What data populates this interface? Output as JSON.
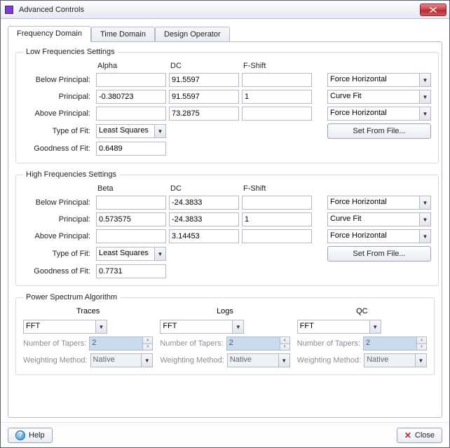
{
  "window": {
    "title": "Advanced Controls"
  },
  "tabs": {
    "freq": "Frequency Domain",
    "time": "Time Domain",
    "design": "Design Operator"
  },
  "low": {
    "legend": "Low Frequencies Settings",
    "hdr_alpha": "Alpha",
    "hdr_dc": "DC",
    "hdr_fshift": "F-Shift",
    "lbl_below": "Below Principal:",
    "lbl_principal": "Principal:",
    "lbl_above": "Above Principal:",
    "lbl_typefit": "Type of Fit:",
    "lbl_goodfit": "Goodness of Fit:",
    "below": {
      "alpha": "",
      "dc": "91.5597",
      "fshift": "",
      "mode": "Force Horizontal"
    },
    "principal": {
      "alpha": "-0.380723",
      "dc": "91.5597",
      "fshift": "1",
      "mode": "Curve Fit"
    },
    "above": {
      "alpha": "",
      "dc": "73.2875",
      "fshift": "",
      "mode": "Force Horizontal"
    },
    "typefit": "Least Squares",
    "setfromfile": "Set From File...",
    "goodfit": "0.6489"
  },
  "high": {
    "legend": "High Frequencies Settings",
    "hdr_beta": "Beta",
    "hdr_dc": "DC",
    "hdr_fshift": "F-Shift",
    "lbl_below": "Below Principal:",
    "lbl_principal": "Principal:",
    "lbl_above": "Above Principal:",
    "lbl_typefit": "Type of Fit:",
    "lbl_goodfit": "Goodness of Fit:",
    "below": {
      "beta": "",
      "dc": "-24.3833",
      "fshift": "",
      "mode": "Force Horizontal"
    },
    "principal": {
      "beta": "0.573575",
      "dc": "-24.3833",
      "fshift": "1",
      "mode": "Curve Fit"
    },
    "above": {
      "beta": "",
      "dc": "3.14453",
      "fshift": "",
      "mode": "Force Horizontal"
    },
    "typefit": "Least Squares",
    "setfromfile": "Set From File...",
    "goodfit": "0.7731"
  },
  "psa": {
    "legend": "Power Spectrum Algorithm",
    "hdr_traces": "Traces",
    "hdr_logs": "Logs",
    "hdr_qc": "QC",
    "lbl_tapers": "Number of Tapers:",
    "lbl_wmethod": "Weighting Method:",
    "traces": {
      "algo": "FFT",
      "tapers": "2",
      "wmethod": "Native"
    },
    "logs": {
      "algo": "FFT",
      "tapers": "2",
      "wmethod": "Native"
    },
    "qc": {
      "algo": "FFT",
      "tapers": "2",
      "wmethod": "Native"
    }
  },
  "footer": {
    "help": "Help",
    "close": "Close"
  }
}
